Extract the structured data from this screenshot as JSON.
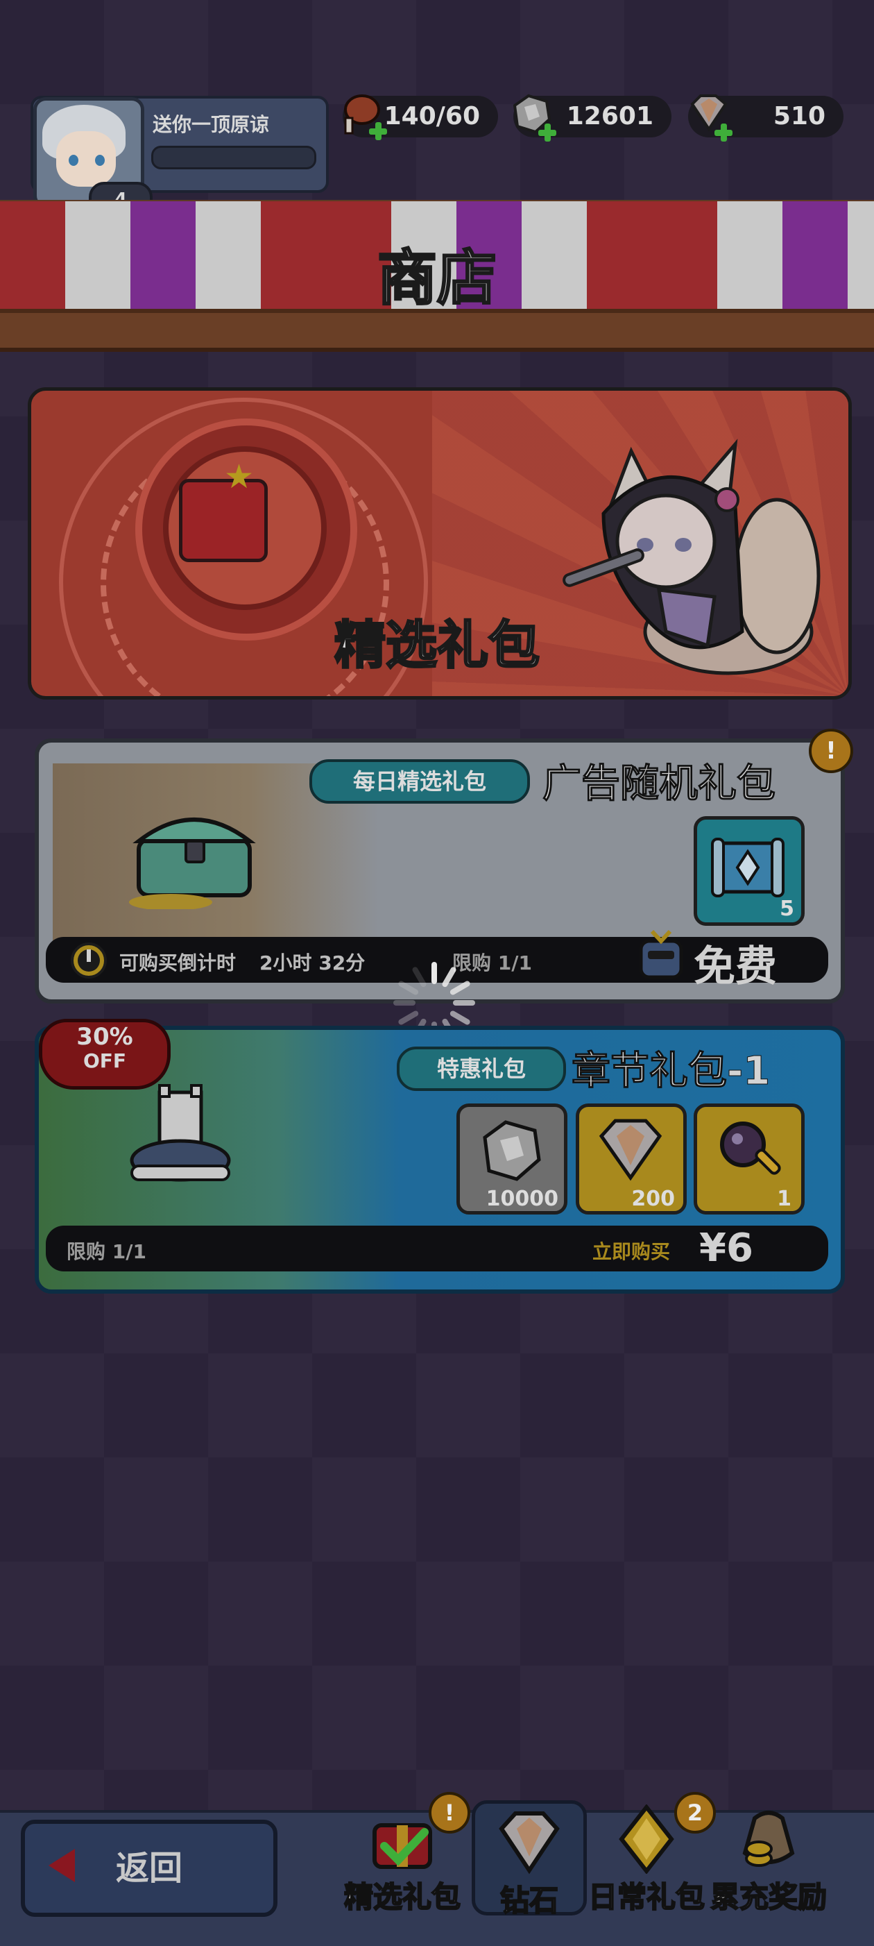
{
  "player": {
    "name": "送你一顶原谅",
    "level": "4"
  },
  "resources": [
    {
      "icon": "meat-icon",
      "value": "140/60"
    },
    {
      "icon": "silver-ore-icon",
      "value": "12601"
    },
    {
      "icon": "diamond-icon",
      "value": "510"
    }
  ],
  "shop": {
    "title": "商店"
  },
  "featured": {
    "title": "精选礼包"
  },
  "ad_pack": {
    "tag": "每日精选礼包",
    "title": "广告随机礼包",
    "item_count": "5",
    "countdown_label": "可购买倒计时",
    "countdown_value": "2小时 32分",
    "limit": "限购 1/1",
    "price": "免费",
    "alert": "!"
  },
  "chapter_pack": {
    "discount_pct": "30%",
    "discount_off": "OFF",
    "tag": "特惠礼包",
    "title": "章节礼包-1",
    "items": [
      {
        "icon": "silver-ore-icon",
        "count": "10000"
      },
      {
        "icon": "diamond-icon",
        "count": "200"
      },
      {
        "icon": "magnifier-key-icon",
        "count": "1"
      }
    ],
    "limit": "限购 1/1",
    "buy_label": "立即购买",
    "price": "¥6"
  },
  "nav": {
    "back": "返回",
    "tabs": [
      {
        "label": "精选礼包",
        "icon": "gift-check-icon",
        "badge": "!"
      },
      {
        "label": "钻石",
        "icon": "diamond-icon",
        "badge": ""
      },
      {
        "label": "日常礼包",
        "icon": "gold-diamond-icon",
        "badge": "2"
      },
      {
        "label": "累充奖励",
        "icon": "coin-bag-icon",
        "badge": ""
      }
    ]
  }
}
